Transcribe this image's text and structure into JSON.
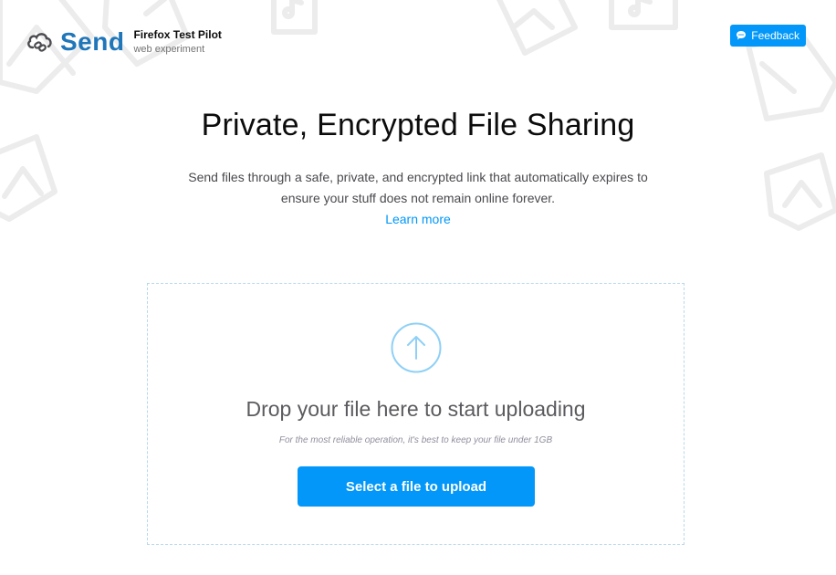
{
  "header": {
    "logo_text": "Send",
    "test_pilot_title": "Firefox Test Pilot",
    "test_pilot_sub": "web experiment"
  },
  "feedback": {
    "label": "Feedback"
  },
  "hero": {
    "title": "Private, Encrypted File Sharing",
    "description": "Send files through a safe, private, and encrypted link that automatically expires to ensure your stuff does not remain online forever.",
    "learn_more": "Learn more"
  },
  "upload": {
    "drop_title": "Drop your file here to start uploading",
    "note": "For the most reliable operation, it's best to keep your file under 1GB",
    "button_label": "Select a file to upload"
  },
  "colors": {
    "brand_blue": "#0297f8",
    "logo_blue": "#1f76b9",
    "upload_circle": "#8fd0f6"
  }
}
